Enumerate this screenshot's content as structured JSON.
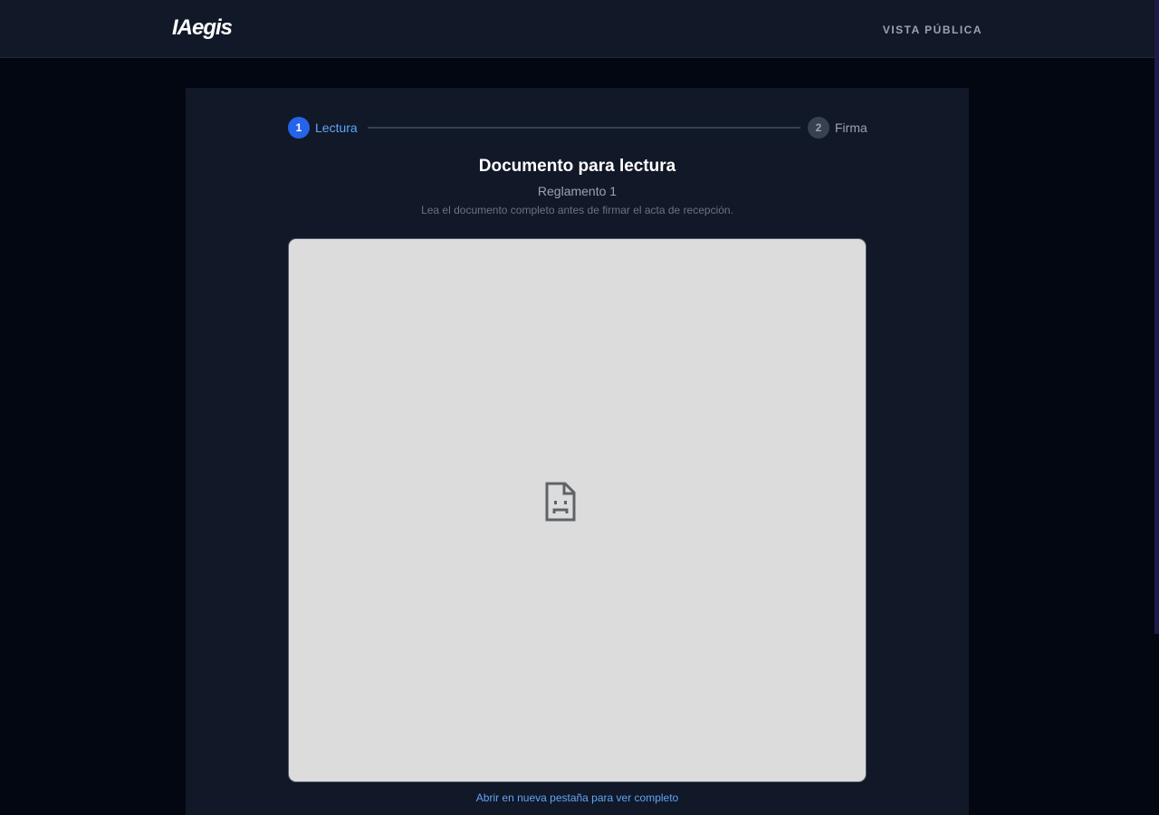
{
  "header": {
    "logo": "IAegis",
    "public_view_label": "VISTA PÚBLICA"
  },
  "stepper": {
    "steps": [
      {
        "number": "1",
        "label": "Lectura",
        "state": "active"
      },
      {
        "number": "2",
        "label": "Firma",
        "state": "pending"
      }
    ]
  },
  "document": {
    "title": "Documento para lectura",
    "name": "Reglamento 1",
    "instructions": "Lea el documento completo antes de firmar el acta de recepción.",
    "viewer_icon": "broken-document-icon",
    "open_link": "Abrir en nueva pestaña para ver completo"
  },
  "colors": {
    "background": "#030712",
    "surface": "#111827",
    "accent": "#2563eb",
    "link": "#60a5fa",
    "viewer": "#dcdcdc"
  }
}
